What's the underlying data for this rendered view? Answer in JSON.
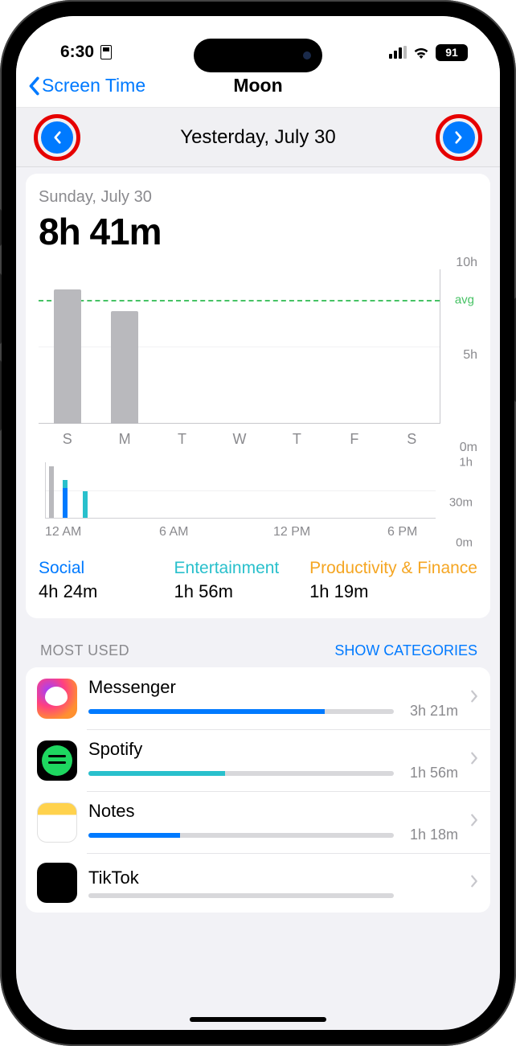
{
  "status": {
    "time": "6:30",
    "battery": "91"
  },
  "nav": {
    "back": "Screen Time",
    "title": "Moon"
  },
  "date_selector": {
    "label": "Yesterday, July 30"
  },
  "summary": {
    "subtitle": "Sunday, July 30",
    "total": "8h 41m"
  },
  "chart_data": {
    "week": {
      "type": "bar",
      "categories": [
        "S",
        "M",
        "T",
        "W",
        "T",
        "F",
        "S"
      ],
      "values": [
        8.7,
        7.3,
        0,
        0,
        0,
        0,
        0
      ],
      "ylim": [
        0,
        10
      ],
      "yticks": [
        {
          "v": 10,
          "label": "10h"
        },
        {
          "v": 5,
          "label": "5h"
        },
        {
          "v": 0,
          "label": "0m"
        }
      ],
      "avg": 8.0,
      "avg_label": "avg"
    },
    "hourly": {
      "type": "bar",
      "x_labels": [
        "12 AM",
        "6 AM",
        "12 PM",
        "6 PM"
      ],
      "ylim": [
        0,
        60
      ],
      "yticks": [
        {
          "v": 60,
          "label": "1h"
        },
        {
          "v": 30,
          "label": "30m"
        },
        {
          "v": 0,
          "label": "0m"
        }
      ],
      "bars": [
        {
          "h": 0,
          "segments": [
            {
              "c": "#b9b9bd",
              "v": 55
            },
            {
              "c": "#007aff",
              "v": 0
            }
          ]
        },
        {
          "h": 1,
          "segments": [
            {
              "c": "#29c0cc",
              "v": 8
            },
            {
              "c": "#007aff",
              "v": 32
            }
          ]
        },
        {
          "h": 2,
          "segments": [
            {
              "c": "#29c0cc",
              "v": 28
            }
          ]
        }
      ]
    }
  },
  "categories": [
    {
      "name": "Social",
      "time": "4h 24m",
      "class": "c-social"
    },
    {
      "name": "Entertainment",
      "time": "1h 56m",
      "class": "c-ent"
    },
    {
      "name": "Productivity & Finance",
      "time": "1h 19m",
      "class": "c-prod"
    }
  ],
  "most_used": {
    "header": "MOST USED",
    "action": "SHOW CATEGORIES",
    "max_minutes": 260,
    "apps": [
      {
        "name": "Messenger",
        "time": "3h 21m",
        "minutes": 201,
        "icon": "icon-messenger",
        "bar": "bar-blue"
      },
      {
        "name": "Spotify",
        "time": "1h 56m",
        "minutes": 116,
        "icon": "icon-spotify",
        "bar": "bar-teal"
      },
      {
        "name": "Notes",
        "time": "1h 18m",
        "minutes": 78,
        "icon": "icon-notes",
        "bar": "bar-blue"
      },
      {
        "name": "TikTok",
        "time": "",
        "minutes": 0,
        "icon": "icon-tiktok",
        "bar": "bar-blue"
      }
    ]
  }
}
